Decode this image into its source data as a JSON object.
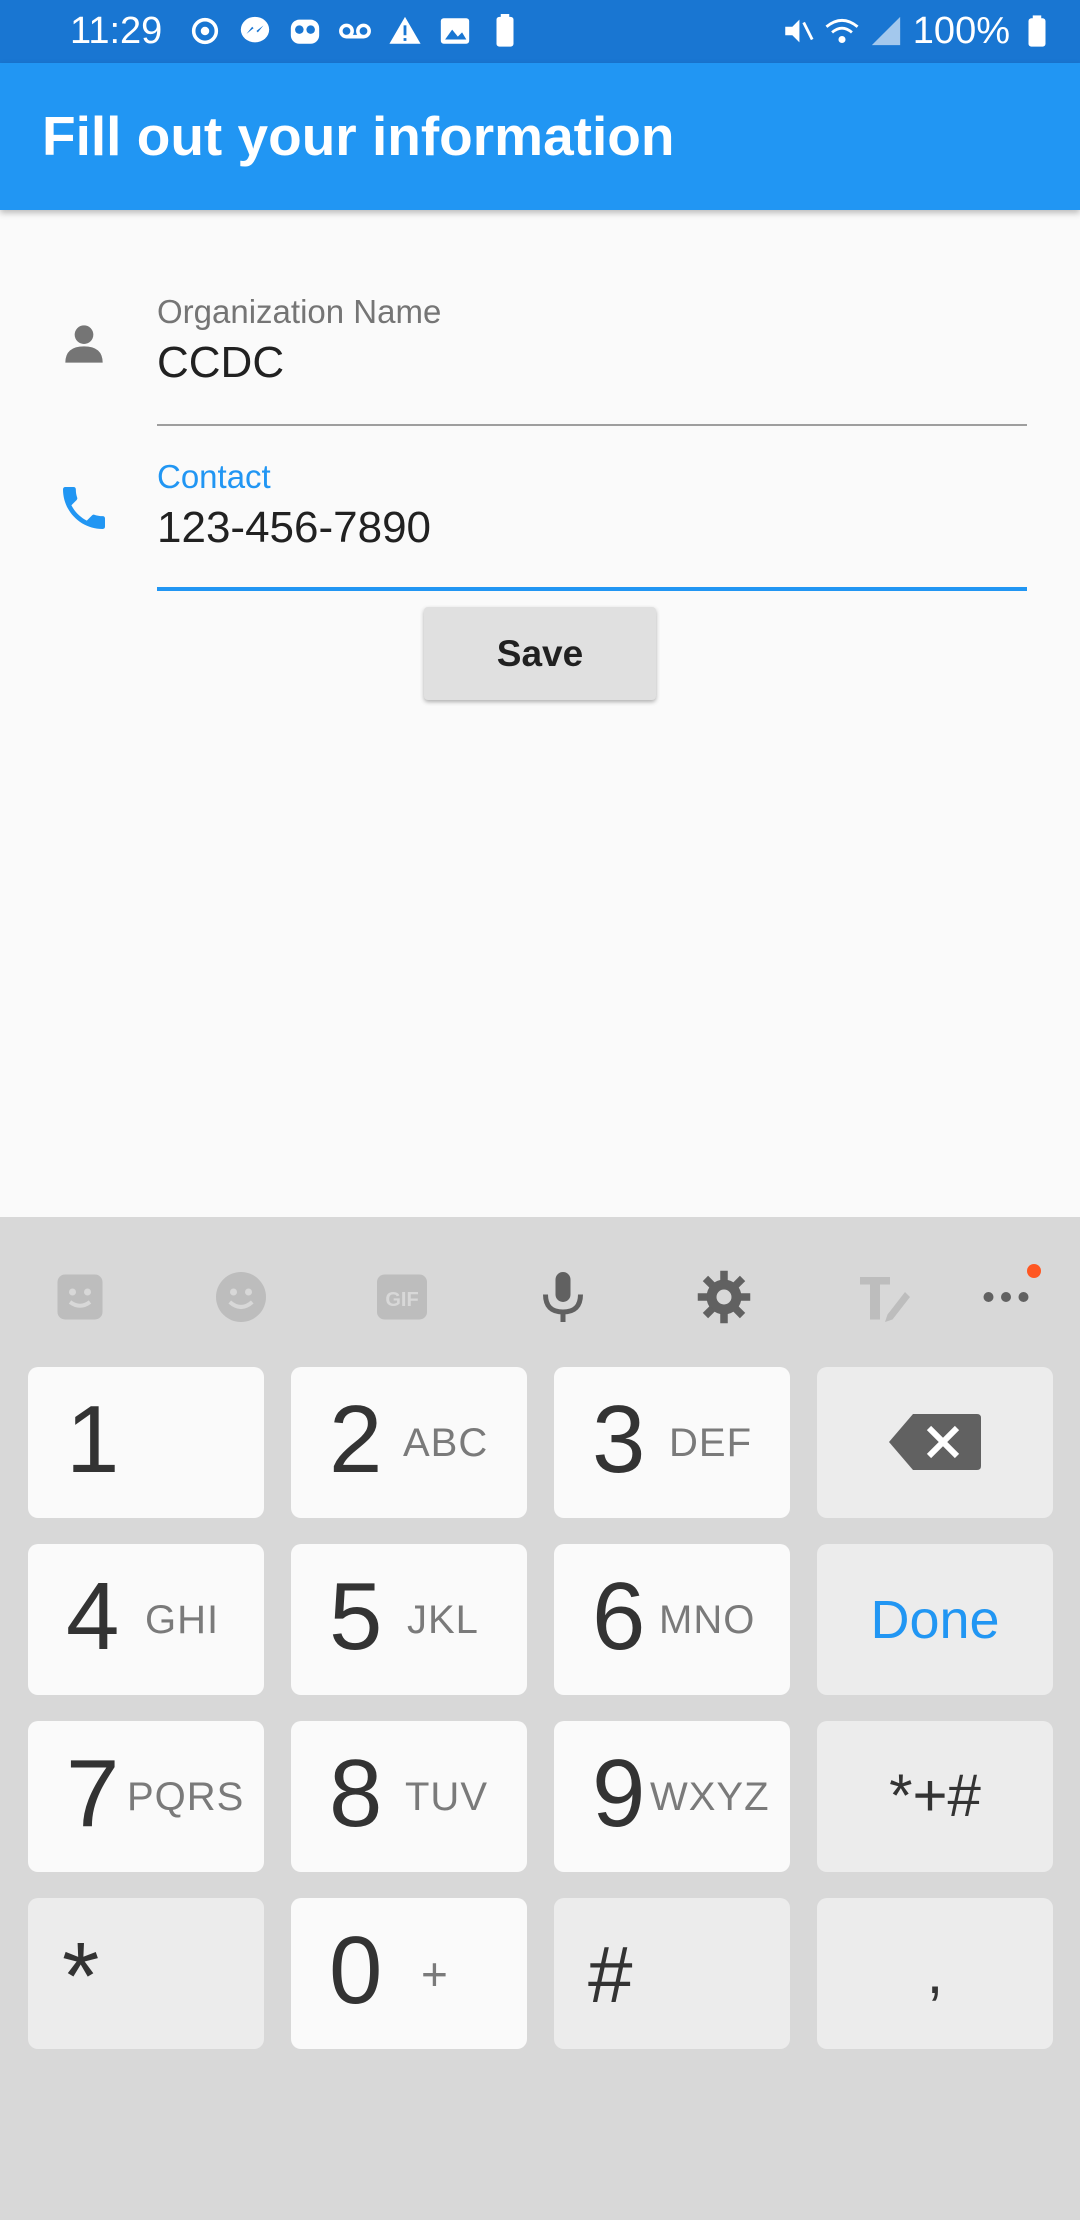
{
  "status_bar": {
    "time": "11:29",
    "battery": "100%",
    "left_icons": [
      "sync-icon",
      "messenger-icon",
      "owl-icon",
      "voicemail-icon",
      "warning-icon",
      "image-icon",
      "battery-100-icon"
    ],
    "right_icons": [
      "mute-icon",
      "wifi-icon",
      "signal-icon",
      "battery-icon"
    ]
  },
  "appbar": {
    "title": "Fill out your information",
    "color": "#2196f3"
  },
  "form": {
    "org_label": "Organization Name",
    "org_value": "CCDC",
    "contact_label": "Contact",
    "contact_value": "123-456-7890",
    "save_label": "Save",
    "accent": "#2196f3"
  },
  "keyboard": {
    "toolbar": [
      "sticker-icon",
      "emoji-icon",
      "gif-icon",
      "mic-icon",
      "settings-icon",
      "handwriting-icon",
      "more-icon"
    ],
    "keys": {
      "k1": {
        "num": "1",
        "letters": ""
      },
      "k2": {
        "num": "2",
        "letters": "ABC"
      },
      "k3": {
        "num": "3",
        "letters": "DEF"
      },
      "k4": {
        "num": "4",
        "letters": "GHI"
      },
      "k5": {
        "num": "5",
        "letters": "JKL"
      },
      "k6": {
        "num": "6",
        "letters": "MNO"
      },
      "k7": {
        "num": "7",
        "letters": "PQRS"
      },
      "k8": {
        "num": "8",
        "letters": "TUV"
      },
      "k9": {
        "num": "9",
        "letters": "WXYZ"
      },
      "k0": {
        "num": "0",
        "letters": "+"
      },
      "star": "*",
      "hash": "#",
      "done": "Done",
      "symbols": "*+#",
      "comma": ","
    }
  }
}
